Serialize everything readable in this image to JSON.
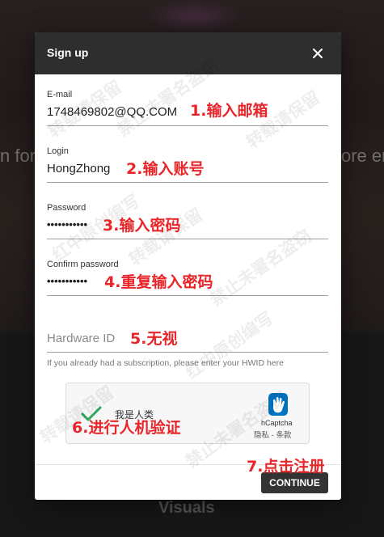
{
  "background": {
    "text_left": "n for",
    "text_right": "ore er",
    "visuals": "Visuals"
  },
  "modal": {
    "title": "Sign up",
    "close_icon": "close-icon",
    "fields": {
      "email": {
        "label": "E-mail",
        "value": "1748469802@QQ.COM"
      },
      "login": {
        "label": "Login",
        "value": "HongZhong"
      },
      "password": {
        "label": "Password",
        "value": "•••••••••••"
      },
      "confirm": {
        "label": "Confirm password",
        "value": "•••••••••••"
      },
      "hwid": {
        "placeholder": "Hardware ID",
        "helper": "If you already had a subscription, please enter your HWID here"
      }
    },
    "captcha": {
      "label": "我是人类",
      "brand": "hCaptcha",
      "terms": "隐私 - 条款"
    },
    "continue_label": "CONTINUE"
  },
  "annotations": {
    "a1": "1.输入邮箱",
    "a2": "2.输入账号",
    "a3": "3.输入密码",
    "a4": "4.重复输入密码",
    "a5": "5.无视",
    "a6": "6.进行人机验证",
    "a7": "7.点击注册"
  },
  "watermark": {
    "w1": "转载请保留",
    "w2": "禁止未署名盗窃",
    "w3": "红中原创编写"
  },
  "colors": {
    "header": "#2e2e2e",
    "annotation": "#e8262a",
    "button": "#333333"
  }
}
